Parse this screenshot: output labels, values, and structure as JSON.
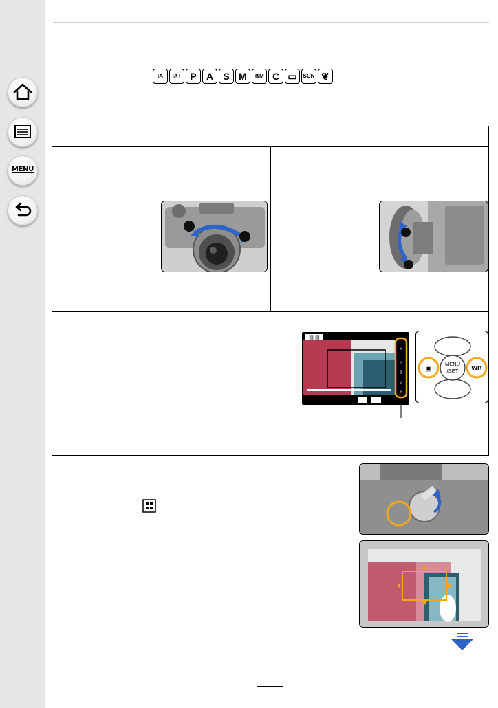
{
  "sidebar": {
    "buttons": [
      {
        "name": "home",
        "icon": "home-icon"
      },
      {
        "name": "contents",
        "icon": "list-icon"
      },
      {
        "name": "menu",
        "label": "MENU",
        "icon": "menu-icon"
      },
      {
        "name": "back",
        "icon": "back-arrow-icon"
      }
    ]
  },
  "mode_icons": [
    "iA",
    "iA+",
    "P",
    "A",
    "S",
    "M",
    "❀M",
    "C",
    "▭",
    "SCN",
    "❦"
  ],
  "colors": {
    "accent_orange": "#f2a81d",
    "arrow_blue": "#2d63c8",
    "rule_blue": "#c5cfe6",
    "sidebar_gray": "#e6e6e6"
  },
  "figures": {
    "lcd_top_label": "▤ ▤",
    "dial_center": "MENU/SET",
    "dial_left": "▣",
    "dial_right": "WB"
  },
  "next_page_icon": "down-arrow-icon"
}
